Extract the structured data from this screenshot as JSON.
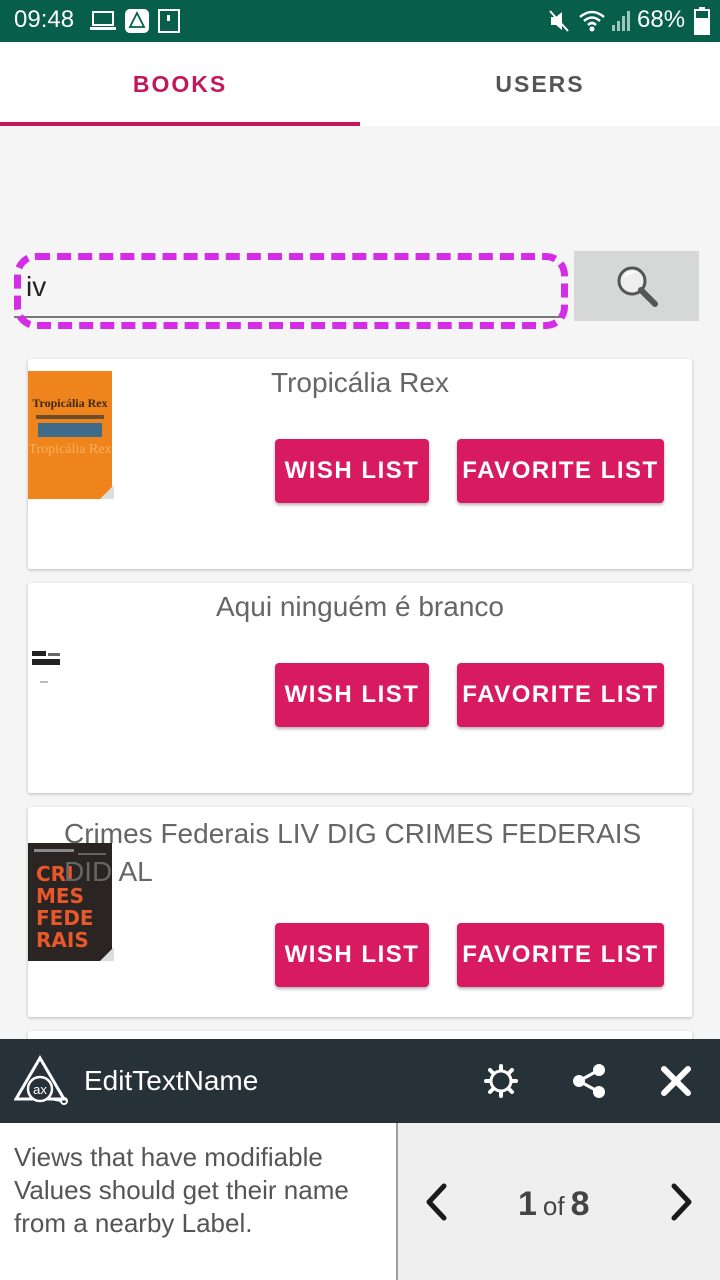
{
  "status_bar": {
    "time": "09:48",
    "battery": "68%"
  },
  "tabs": [
    {
      "label": "BOOKS",
      "active": true
    },
    {
      "label": "USERS",
      "active": false
    }
  ],
  "search": {
    "value": "iv"
  },
  "books": [
    {
      "title": "Tropicália Rex",
      "cover_title": "Tropicália Rex",
      "wish_label": "WISH LIST",
      "favorite_label": "FAVORITE LIST"
    },
    {
      "title": "Aqui ninguém é branco",
      "cover_title": "Aqui ninguém é branco",
      "wish_label": "WISH LIST",
      "favorite_label": "FAVORITE LIST"
    },
    {
      "title": "Crimes Federais LIV DIG CRIMES FEDERAIS DID AL",
      "cover_title": "CRIMES FEDERAIS",
      "wish_label": "WISH LIST",
      "favorite_label": "FAVORITE LIST"
    }
  ],
  "accessibility_panel": {
    "title": "EditTextName",
    "description": "Views that have modifiable Values should get their name from a nearby Label.",
    "current": "1",
    "of_label": "of",
    "total": "8"
  },
  "colors": {
    "status_bar": "#075e4a",
    "accent": "#c2185b",
    "button": "#d81b60",
    "highlight": "#d52ce8",
    "panel_header": "#263238"
  }
}
